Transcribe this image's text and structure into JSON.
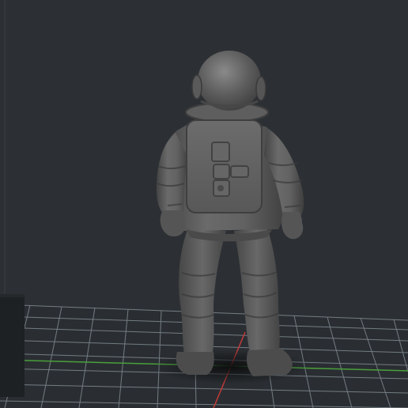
{
  "viewport": {
    "background_color": "#2c3034",
    "model_color": "#5a5a5a",
    "grid_color": "#8c97a0",
    "x_axis_color": "#c23a3a",
    "y_axis_color": "#4aa03c",
    "model_name": "",
    "icons": [
      "astronaut-model",
      "build-plate-grid",
      "build-volume-edge",
      "camera-frustum-block"
    ]
  }
}
